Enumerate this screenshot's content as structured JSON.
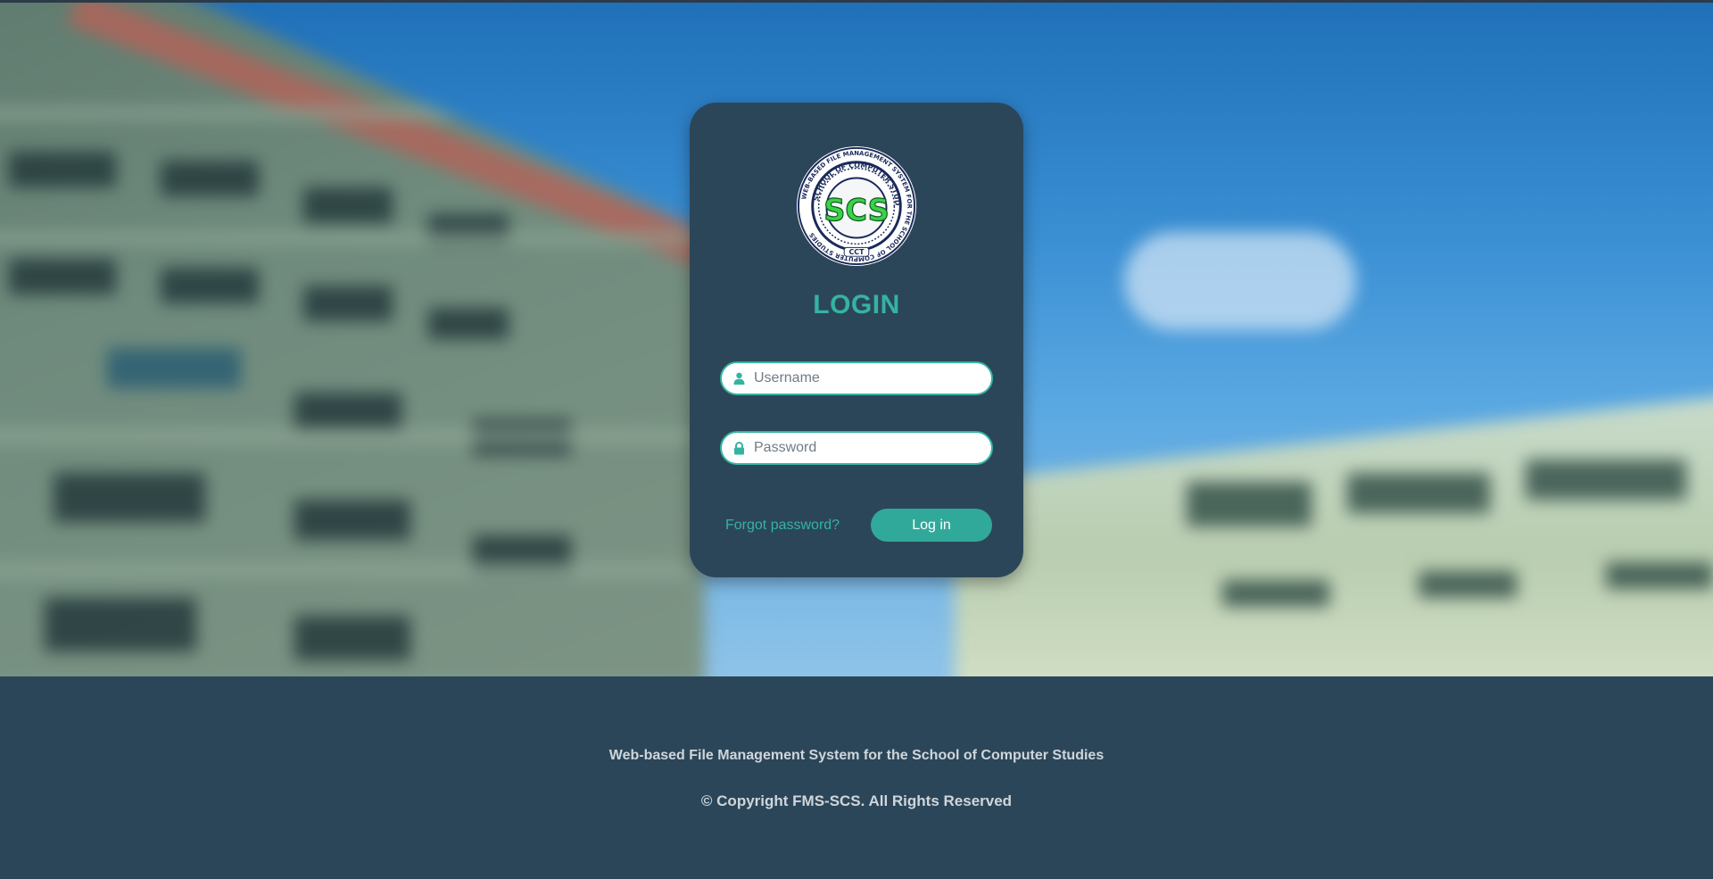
{
  "login": {
    "title": "LOGIN",
    "username_placeholder": "Username",
    "password_placeholder": "Password",
    "forgot_label": "Forgot password?",
    "login_label": "Log in"
  },
  "logo": {
    "ring_text": "WEB-BASED FILE MANAGEMENT SYSTEM FOR THE SCHOOL OF COMPUTER STUDIES",
    "inner_text": "SCHOOL OF COMPUTER STUDIES",
    "emblem": "SCS",
    "bottom_tag": "CCT"
  },
  "footer": {
    "system_name": "Web-based File Management System for the School of Computer Studies",
    "copyright": "© Copyright FMS-SCS. All Rights Reserved"
  },
  "colors": {
    "accent": "#35b3a1",
    "card": "#2c4659",
    "footer": "#2c4659"
  },
  "icons": {
    "username": "user-icon",
    "password": "lock-icon"
  }
}
